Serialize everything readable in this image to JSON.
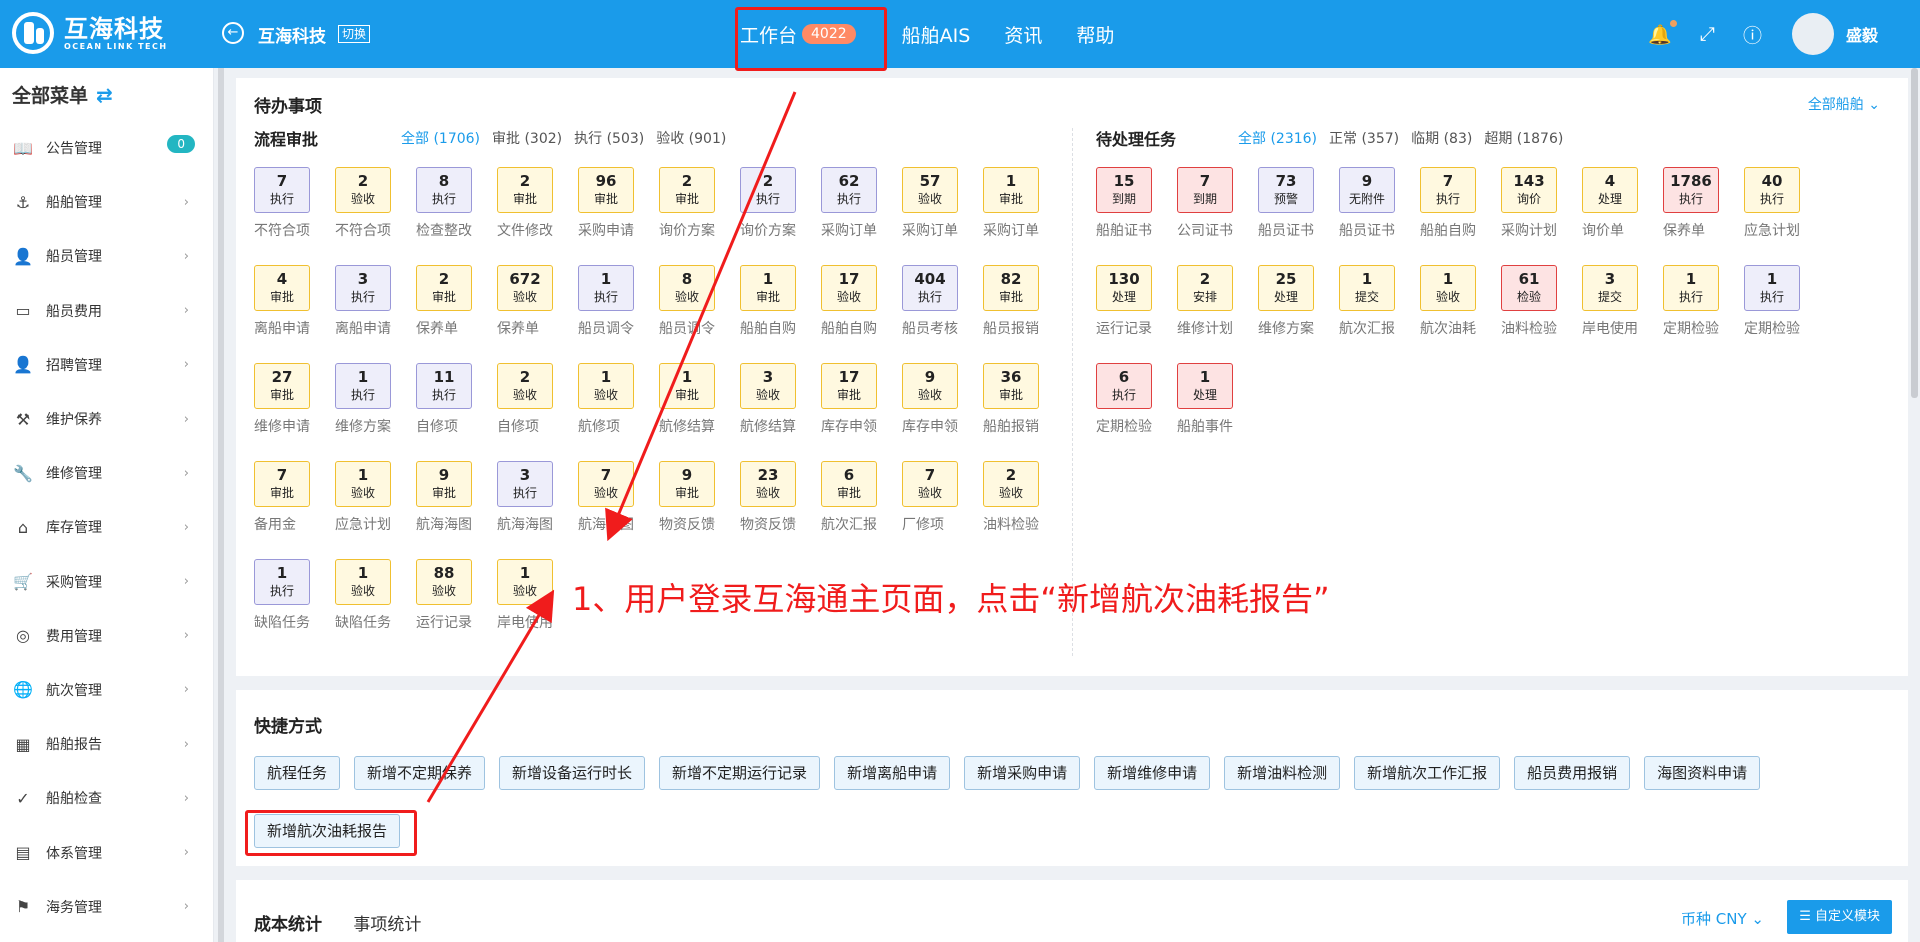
{
  "header": {
    "logo_cn": "互海科技",
    "logo_en": "OCEAN LINK TECH",
    "company": "互海科技",
    "switch_label": "切换",
    "nav": [
      {
        "label": "工作台",
        "badge": "4022"
      },
      {
        "label": "船舶AIS"
      },
      {
        "label": "资讯"
      },
      {
        "label": "帮助"
      }
    ],
    "username": "盛毅"
  },
  "sidebar": {
    "title": "全部菜单",
    "items": [
      {
        "label": "公告管理",
        "icon": "book-icon",
        "badge": "0"
      },
      {
        "label": "船舶管理",
        "icon": "anchor-icon"
      },
      {
        "label": "船员管理",
        "icon": "user-icon"
      },
      {
        "label": "船员费用",
        "icon": "wallet-icon"
      },
      {
        "label": "招聘管理",
        "icon": "recruit-icon"
      },
      {
        "label": "维护保养",
        "icon": "hammer-icon"
      },
      {
        "label": "维修管理",
        "icon": "wrench-icon"
      },
      {
        "label": "库存管理",
        "icon": "house-icon"
      },
      {
        "label": "采购管理",
        "icon": "cart-icon"
      },
      {
        "label": "费用管理",
        "icon": "coins-icon"
      },
      {
        "label": "航次管理",
        "icon": "globe-icon"
      },
      {
        "label": "船舶报告",
        "icon": "calendar-icon"
      },
      {
        "label": "船舶检查",
        "icon": "check-circle-icon"
      },
      {
        "label": "体系管理",
        "icon": "document-icon"
      },
      {
        "label": "海务管理",
        "icon": "signpost-icon"
      }
    ]
  },
  "todo": {
    "title": "待办事项",
    "all_ships": "全部船舶",
    "flow": {
      "title": "流程审批",
      "filters": [
        "全部 (1706)",
        "审批 (302)",
        "执行 (503)",
        "验收 (901)"
      ],
      "tiles": [
        {
          "n": "7",
          "s": "执行",
          "c": "p",
          "label": "不符合项"
        },
        {
          "n": "2",
          "s": "验收",
          "c": "y",
          "label": "不符合项"
        },
        {
          "n": "8",
          "s": "执行",
          "c": "p",
          "label": "检查整改"
        },
        {
          "n": "2",
          "s": "审批",
          "c": "y",
          "label": "文件修改"
        },
        {
          "n": "96",
          "s": "审批",
          "c": "y",
          "label": "采购申请"
        },
        {
          "n": "2",
          "s": "审批",
          "c": "y",
          "label": "询价方案"
        },
        {
          "n": "2",
          "s": "执行",
          "c": "p",
          "label": "询价方案"
        },
        {
          "n": "62",
          "s": "执行",
          "c": "p",
          "label": "采购订单"
        },
        {
          "n": "57",
          "s": "验收",
          "c": "y",
          "label": "采购订单"
        },
        {
          "n": "1",
          "s": "审批",
          "c": "y",
          "label": "采购订单"
        },
        {
          "n": "4",
          "s": "审批",
          "c": "y",
          "label": "离船申请"
        },
        {
          "n": "3",
          "s": "执行",
          "c": "p",
          "label": "离船申请"
        },
        {
          "n": "2",
          "s": "审批",
          "c": "y",
          "label": "保养单"
        },
        {
          "n": "672",
          "s": "验收",
          "c": "y",
          "label": "保养单"
        },
        {
          "n": "1",
          "s": "执行",
          "c": "p",
          "label": "船员调令"
        },
        {
          "n": "8",
          "s": "验收",
          "c": "y",
          "label": "船员调令"
        },
        {
          "n": "1",
          "s": "审批",
          "c": "y",
          "label": "船舶自购"
        },
        {
          "n": "17",
          "s": "验收",
          "c": "y",
          "label": "船舶自购"
        },
        {
          "n": "404",
          "s": "执行",
          "c": "p",
          "label": "船员考核"
        },
        {
          "n": "82",
          "s": "审批",
          "c": "y",
          "label": "船员报销"
        },
        {
          "n": "27",
          "s": "审批",
          "c": "y",
          "label": "维修申请"
        },
        {
          "n": "1",
          "s": "执行",
          "c": "p",
          "label": "维修方案"
        },
        {
          "n": "11",
          "s": "执行",
          "c": "p",
          "label": "自修项"
        },
        {
          "n": "2",
          "s": "验收",
          "c": "y",
          "label": "自修项"
        },
        {
          "n": "1",
          "s": "验收",
          "c": "y",
          "label": "航修项"
        },
        {
          "n": "1",
          "s": "审批",
          "c": "y",
          "label": "航修结算"
        },
        {
          "n": "3",
          "s": "验收",
          "c": "y",
          "label": "航修结算"
        },
        {
          "n": "17",
          "s": "审批",
          "c": "y",
          "label": "库存申领"
        },
        {
          "n": "9",
          "s": "验收",
          "c": "y",
          "label": "库存申领"
        },
        {
          "n": "36",
          "s": "审批",
          "c": "y",
          "label": "船舶报销"
        },
        {
          "n": "7",
          "s": "审批",
          "c": "y",
          "label": "备用金"
        },
        {
          "n": "1",
          "s": "验收",
          "c": "y",
          "label": "应急计划"
        },
        {
          "n": "9",
          "s": "审批",
          "c": "y",
          "label": "航海海图"
        },
        {
          "n": "3",
          "s": "执行",
          "c": "p",
          "label": "航海海图"
        },
        {
          "n": "7",
          "s": "验收",
          "c": "y",
          "label": "航海海图"
        },
        {
          "n": "9",
          "s": "审批",
          "c": "y",
          "label": "物资反馈"
        },
        {
          "n": "23",
          "s": "验收",
          "c": "y",
          "label": "物资反馈"
        },
        {
          "n": "6",
          "s": "审批",
          "c": "y",
          "label": "航次汇报"
        },
        {
          "n": "7",
          "s": "验收",
          "c": "y",
          "label": "厂修项"
        },
        {
          "n": "2",
          "s": "验收",
          "c": "y",
          "label": "油料检验"
        },
        {
          "n": "1",
          "s": "执行",
          "c": "p",
          "label": "缺陷任务"
        },
        {
          "n": "1",
          "s": "验收",
          "c": "y",
          "label": "缺陷任务"
        },
        {
          "n": "88",
          "s": "验收",
          "c": "y",
          "label": "运行记录"
        },
        {
          "n": "1",
          "s": "验收",
          "c": "y",
          "label": "岸电使用"
        }
      ]
    },
    "pending": {
      "title": "待处理任务",
      "filters": [
        "全部 (2316)",
        "正常 (357)",
        "临期 (83)",
        "超期 (1876)"
      ],
      "tiles": [
        {
          "n": "15",
          "s": "到期",
          "c": "r",
          "label": "船舶证书"
        },
        {
          "n": "7",
          "s": "到期",
          "c": "r",
          "label": "公司证书"
        },
        {
          "n": "73",
          "s": "预警",
          "c": "p",
          "label": "船员证书"
        },
        {
          "n": "9",
          "s": "无附件",
          "c": "p",
          "label": "船员证书"
        },
        {
          "n": "7",
          "s": "执行",
          "c": "y",
          "label": "船舶自购"
        },
        {
          "n": "143",
          "s": "询价",
          "c": "y",
          "label": "采购计划"
        },
        {
          "n": "4",
          "s": "处理",
          "c": "y",
          "label": "询价单"
        },
        {
          "n": "1786",
          "s": "执行",
          "c": "r",
          "label": "保养单"
        },
        {
          "n": "40",
          "s": "执行",
          "c": "y",
          "label": "应急计划"
        },
        {
          "n": "130",
          "s": "处理",
          "c": "y",
          "label": "运行记录"
        },
        {
          "n": "2",
          "s": "安排",
          "c": "y",
          "label": "维修计划"
        },
        {
          "n": "25",
          "s": "处理",
          "c": "y",
          "label": "维修方案"
        },
        {
          "n": "1",
          "s": "提交",
          "c": "y",
          "label": "航次汇报"
        },
        {
          "n": "1",
          "s": "验收",
          "c": "y",
          "label": "航次油耗"
        },
        {
          "n": "61",
          "s": "检验",
          "c": "r",
          "label": "油料检验"
        },
        {
          "n": "3",
          "s": "提交",
          "c": "y",
          "label": "岸电使用"
        },
        {
          "n": "1",
          "s": "执行",
          "c": "y",
          "label": "定期检验"
        },
        {
          "n": "1",
          "s": "执行",
          "c": "p",
          "label": "定期检验"
        },
        {
          "n": "6",
          "s": "执行",
          "c": "r",
          "label": "定期检验"
        },
        {
          "n": "1",
          "s": "处理",
          "c": "r",
          "label": "船舶事件"
        }
      ]
    }
  },
  "shortcuts": {
    "title": "快捷方式",
    "buttons": [
      "航程任务",
      "新增不定期保养",
      "新增设备运行时长",
      "新增不定期运行记录",
      "新增离船申请",
      "新增采购申请",
      "新增维修申请",
      "新增油料检测",
      "新增航次工作汇报",
      "船员费用报销",
      "海图资料申请",
      "新增航次油耗报告"
    ]
  },
  "cost": {
    "tabs": [
      "成本统计",
      "事项统计"
    ],
    "currency": "币种 CNY",
    "custom_button": "自定义模块"
  },
  "annotation": "1、用户登录互海通主页面，点击“新增航次油耗报告”",
  "colors": {
    "primary": "#1a9bea",
    "highlight": "#f01c1c",
    "badge": "#ff8a65"
  }
}
